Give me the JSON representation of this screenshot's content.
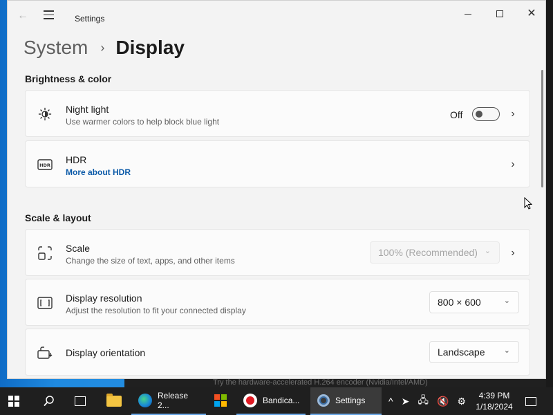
{
  "window": {
    "app_title": "Settings",
    "breadcrumb": {
      "parent": "System",
      "separator": "›",
      "current": "Display"
    }
  },
  "sections": {
    "brightness": {
      "title": "Brightness & color"
    },
    "scale": {
      "title": "Scale & layout"
    }
  },
  "settings": {
    "night_light": {
      "title": "Night light",
      "subtitle": "Use warmer colors to help block blue light",
      "state_label": "Off",
      "enabled": false
    },
    "hdr": {
      "title": "HDR",
      "link": "More about HDR"
    },
    "scale": {
      "title": "Scale",
      "subtitle": "Change the size of text, apps, and other items",
      "value": "100% (Recommended)",
      "disabled": true
    },
    "resolution": {
      "title": "Display resolution",
      "subtitle": "Adjust the resolution to fit your connected display",
      "value": "800 × 600"
    },
    "orientation": {
      "title": "Display orientation",
      "value": "Landscape"
    }
  },
  "background_text": "Try the hardware-accelerated H.264 encoder (Nvidia/Intel/AMD)",
  "taskbar": {
    "apps": [
      {
        "label": "Release 2...",
        "icon": "edge-icon"
      },
      {
        "label": "Bandica...",
        "icon": "bandicam-icon"
      },
      {
        "label": "Settings",
        "icon": "settings-gear-icon"
      }
    ],
    "clock": {
      "time": "4:39 PM",
      "date": "1/18/2024"
    }
  },
  "icons": {
    "back": "back-arrow-icon",
    "menu": "hamburger-menu-icon",
    "night_light": "brightness-icon",
    "hdr": "hdr-icon",
    "scale": "scale-icon",
    "resolution": "resolution-icon",
    "orientation": "orientation-icon"
  },
  "colors": {
    "accent": "#0b5aa8",
    "window_bg": "#f3f3f3",
    "card_bg": "#fbfbfb",
    "taskbar_bg": "#1f1f1f"
  }
}
